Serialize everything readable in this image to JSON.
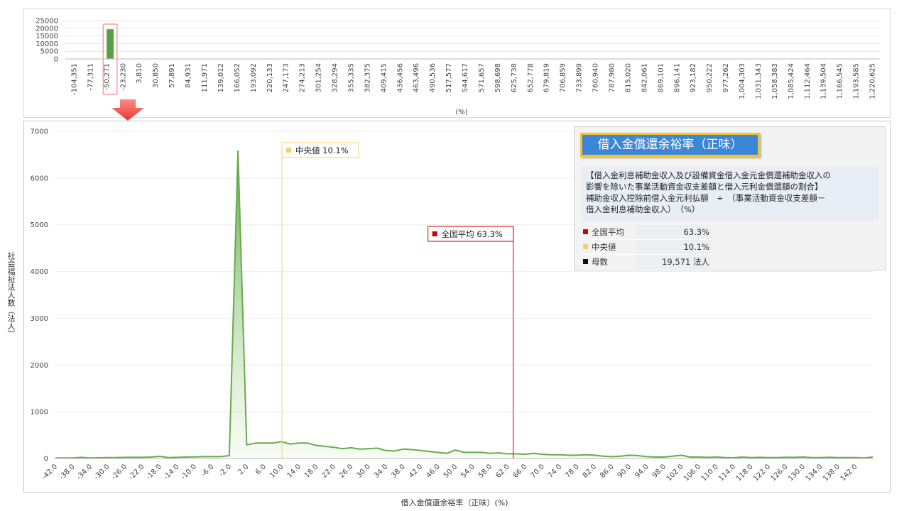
{
  "colors": {
    "series": "#6aaa4a",
    "mean": "#cc0000",
    "median": "#f5d070",
    "count": "#111111",
    "accent_title": "#3b86d6"
  },
  "info": {
    "title": "借入金償還余裕率（正味）",
    "desc_lines": [
      "【借入金利息補助金収入及び設備資金借入金元金償還補助金収入の",
      "影響を除いた事業活動資金収支差額と借入元利金償還額の割合】",
      "補助金収入控除前借入金元利払額　÷　（事業活動資金収支差額－",
      "借入金利息補助金収入）　（%）"
    ],
    "stats": [
      {
        "label": "全国平均",
        "value": "63.3%",
        "color": "#cc0000"
      },
      {
        "label": "中央値",
        "value": "10.1%",
        "color": "#f5d070"
      },
      {
        "label": "母数",
        "value": "19,571  法人",
        "color": "#111111"
      }
    ]
  },
  "labels": {
    "mean_marker": "全国平均  63.3%",
    "median_marker": "中央値  10.1%",
    "main_xlabel": "借入金償還余裕率（正味）(%)",
    "main_ylabel": "社会福祉法人数（法人）",
    "top_xlabel": "(%)"
  },
  "chart_data": [
    {
      "type": "bar",
      "title": "",
      "xlabel": "(%)",
      "ylim": [
        0,
        25000
      ],
      "yticks": [
        0,
        5000,
        10000,
        15000,
        20000,
        25000
      ],
      "categories": [
        "-104,351",
        "-77,311",
        "-50,271",
        "-23,230",
        "3,810",
        "30,850",
        "57,891",
        "84,931",
        "111,971",
        "139,012",
        "166,052",
        "193,092",
        "220,133",
        "247,173",
        "274,213",
        "301,254",
        "328,294",
        "355,335",
        "382,375",
        "409,415",
        "436,456",
        "463,496",
        "490,536",
        "517,577",
        "544,617",
        "571,657",
        "598,698",
        "625,738",
        "652,778",
        "679,819",
        "706,859",
        "733,899",
        "760,940",
        "787,980",
        "815,020",
        "842,061",
        "869,101",
        "896,141",
        "923,182",
        "950,222",
        "977,262",
        "1,004,303",
        "1,031,343",
        "1,058,383",
        "1,085,424",
        "1,112,464",
        "1,139,504",
        "1,166,545",
        "1,193,585",
        "1,220,625"
      ],
      "values": [
        0,
        80,
        80,
        0,
        80,
        19350,
        80,
        80,
        0,
        80,
        0,
        80,
        0,
        0,
        0,
        0,
        0,
        0,
        0,
        0,
        0,
        0,
        0,
        0,
        0,
        0,
        0,
        0,
        0,
        0,
        0,
        0,
        0,
        0,
        0,
        0,
        0,
        0,
        0,
        0,
        0,
        0,
        0,
        0,
        0,
        0,
        0,
        0,
        0,
        0,
        0,
        0,
        0,
        0,
        0,
        0,
        0,
        0,
        0,
        0,
        0,
        0,
        0,
        0,
        0,
        0,
        0,
        0,
        0,
        0,
        0,
        0,
        0,
        0,
        0,
        0,
        0,
        0,
        0,
        0,
        0,
        0,
        0,
        0,
        0,
        0,
        0,
        0,
        0,
        0,
        0,
        0,
        0,
        0,
        0,
        0,
        0,
        0,
        0,
        80
      ],
      "highlight_index": 5
    },
    {
      "type": "area",
      "title": "",
      "xlabel": "借入金償還余裕率（正味）(%)",
      "ylabel": "社会福祉法人数（法人）",
      "xlim": [
        -42,
        146
      ],
      "ylim": [
        0,
        7000
      ],
      "yticks": [
        0,
        1000,
        2000,
        3000,
        4000,
        5000,
        6000,
        7000
      ],
      "xtick_labels": [
        "-42.0",
        "-38.0",
        "-34.0",
        "-30.0",
        "-26.0",
        "-22.0",
        "-18.0",
        "-14.0",
        "-10.0",
        "-6.0",
        "-2.0",
        "2.0",
        "6.0",
        "10.0",
        "14.0",
        "18.0",
        "22.0",
        "26.0",
        "30.0",
        "34.0",
        "38.0",
        "42.0",
        "46.0",
        "50.0",
        "54.0",
        "58.0",
        "62.0",
        "66.0",
        "70.0",
        "74.0",
        "78.0",
        "82.0",
        "86.0",
        "90.0",
        "94.0",
        "98.0",
        "102.0",
        "106.0",
        "110.0",
        "114.0",
        "118.0",
        "122.0",
        "126.0",
        "130.0",
        "134.0",
        "138.0",
        "142.0"
      ],
      "x": [
        -42,
        -40,
        -38,
        -36,
        -34,
        -32,
        -30,
        -28,
        -26,
        -24,
        -22,
        -20,
        -18,
        -16,
        -14,
        -12,
        -10,
        -8,
        -6,
        -4,
        -2,
        0,
        2,
        4,
        6,
        8,
        10,
        12,
        14,
        16,
        18,
        20,
        22,
        24,
        26,
        28,
        30,
        32,
        34,
        36,
        38,
        40,
        42,
        44,
        46,
        48,
        50,
        52,
        54,
        56,
        58,
        60,
        62,
        64,
        66,
        68,
        70,
        72,
        74,
        76,
        78,
        80,
        82,
        84,
        86,
        88,
        90,
        92,
        94,
        96,
        98,
        100,
        102,
        104,
        106,
        108,
        110,
        112,
        114,
        116,
        118,
        120,
        122,
        124,
        126,
        128,
        130,
        132,
        134,
        136,
        138,
        140,
        142,
        144,
        146
      ],
      "y": [
        10,
        10,
        10,
        25,
        10,
        15,
        20,
        20,
        25,
        25,
        25,
        30,
        45,
        20,
        25,
        30,
        35,
        40,
        40,
        40,
        60,
        6580,
        290,
        330,
        330,
        330,
        360,
        310,
        330,
        330,
        280,
        260,
        240,
        210,
        230,
        200,
        210,
        220,
        170,
        160,
        200,
        190,
        170,
        150,
        130,
        110,
        180,
        130,
        130,
        130,
        110,
        120,
        100,
        100,
        90,
        110,
        90,
        80,
        80,
        70,
        70,
        80,
        70,
        50,
        40,
        50,
        70,
        60,
        40,
        30,
        30,
        50,
        70,
        30,
        30,
        25,
        30,
        20,
        15,
        30,
        20,
        25,
        20,
        20,
        25,
        25,
        30,
        20,
        20,
        25,
        20,
        20,
        20,
        10,
        30
      ]
    }
  ]
}
